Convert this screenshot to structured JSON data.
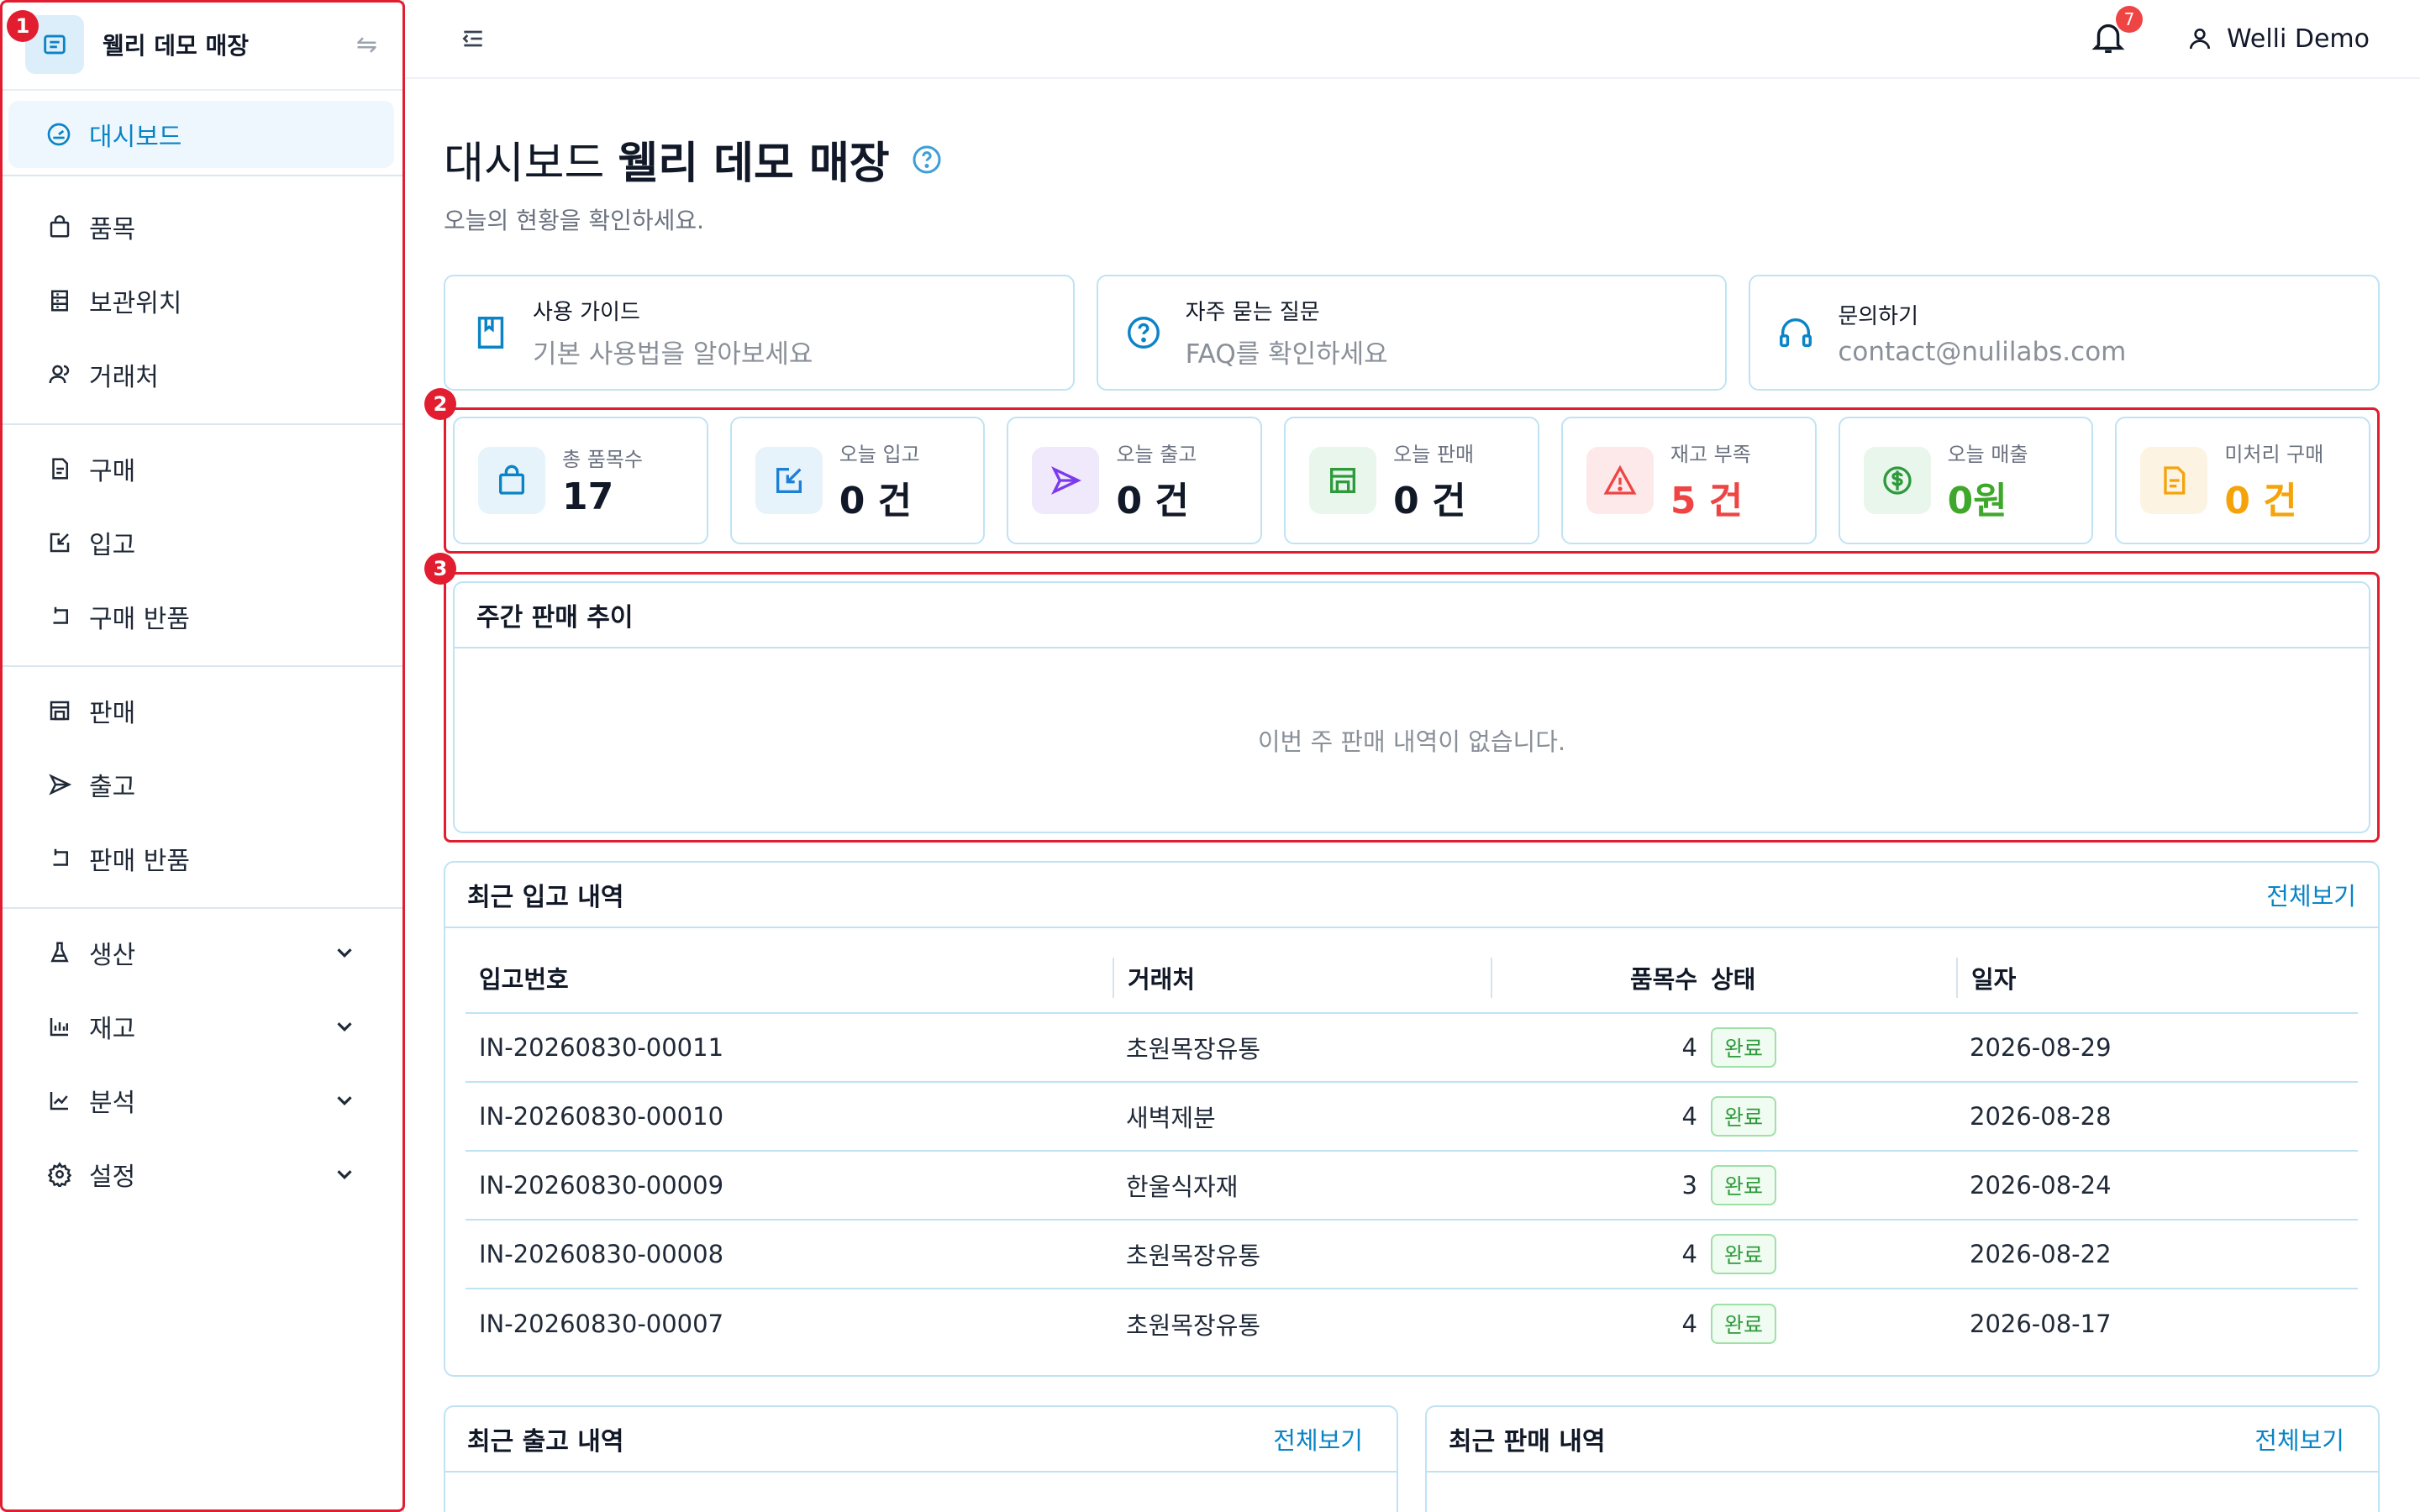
{
  "sidebar": {
    "store_name": "웰리 데모 매장",
    "active_item": "대시보드",
    "groups": [
      [
        {
          "label": "품목"
        },
        {
          "label": "보관위치"
        },
        {
          "label": "거래처"
        }
      ],
      [
        {
          "label": "구매"
        },
        {
          "label": "입고"
        },
        {
          "label": "구매 반품"
        }
      ],
      [
        {
          "label": "판매"
        },
        {
          "label": "출고"
        },
        {
          "label": "판매 반품"
        }
      ],
      [
        {
          "label": "생산"
        },
        {
          "label": "재고"
        },
        {
          "label": "분석"
        },
        {
          "label": "설정"
        }
      ]
    ]
  },
  "topbar": {
    "notification_count": "7",
    "user_name": "Welli Demo"
  },
  "page": {
    "title_prefix": "대시보드",
    "title_store": "웰리 데모 매장",
    "subtitle": "오늘의 현황을 확인하세요."
  },
  "info_cards": [
    {
      "title": "사용 가이드",
      "desc": "기본 사용법을 알아보세요"
    },
    {
      "title": "자주 묻는 질문",
      "desc": "FAQ를 확인하세요"
    },
    {
      "title": "문의하기",
      "desc": "contact@nulilabs.com"
    }
  ],
  "stats": [
    {
      "label": "총 품목수",
      "value": "17",
      "color": "#111827",
      "bg": "#e6f3fb",
      "icon_color": "#0a84c6",
      "icon": "bag-icon"
    },
    {
      "label": "오늘 입고",
      "value": "0 건",
      "color": "#111827",
      "bg": "#e6f3fb",
      "icon_color": "#1d7fd8",
      "icon": "edit-icon"
    },
    {
      "label": "오늘 출고",
      "value": "0 건",
      "color": "#111827",
      "bg": "#efe9fb",
      "icon_color": "#7c3aed",
      "icon": "send-icon"
    },
    {
      "label": "오늘 판매",
      "value": "0 건",
      "color": "#111827",
      "bg": "#e8f6ec",
      "icon_color": "#2e9a3c",
      "icon": "store-icon"
    },
    {
      "label": "재고 부족",
      "value": "5 건",
      "color": "#ef4444",
      "bg": "#fde9ea",
      "icon_color": "#ef4444",
      "icon": "alert-icon"
    },
    {
      "label": "오늘 매출",
      "value": "0원",
      "color": "#3fa82c",
      "bg": "#e8f6ec",
      "icon_color": "#2e9a3c",
      "icon": "dollar-icon"
    },
    {
      "label": "미처리 구매",
      "value": "0 건",
      "color": "#f5a30a",
      "bg": "#fdf3e2",
      "icon_color": "#f5a30a",
      "icon": "doc-icon"
    }
  ],
  "markers": [
    "1",
    "2",
    "3"
  ],
  "weekly": {
    "title": "주간 판매 추이",
    "empty": "이번 주 판매 내역이 없습니다."
  },
  "recent_in": {
    "title": "최근 입고 내역",
    "view_all": "전체보기",
    "headers": [
      "입고번호",
      "거래처",
      "품목수",
      "상태",
      "일자"
    ],
    "rows": [
      {
        "no": "IN-20260830-00011",
        "vendor": "초원목장유통",
        "count": "4",
        "status": "완료",
        "date": "2026-08-29"
      },
      {
        "no": "IN-20260830-00010",
        "vendor": "새벽제분",
        "count": "4",
        "status": "완료",
        "date": "2026-08-28"
      },
      {
        "no": "IN-20260830-00009",
        "vendor": "한울식자재",
        "count": "3",
        "status": "완료",
        "date": "2026-08-24"
      },
      {
        "no": "IN-20260830-00008",
        "vendor": "초원목장유통",
        "count": "4",
        "status": "완료",
        "date": "2026-08-22"
      },
      {
        "no": "IN-20260830-00007",
        "vendor": "초원목장유통",
        "count": "4",
        "status": "완료",
        "date": "2026-08-17"
      }
    ]
  },
  "recent_out": {
    "title": "최근 출고 내역",
    "view_all": "전체보기"
  },
  "recent_sales": {
    "title": "최근 판매 내역",
    "view_all": "전체보기"
  }
}
